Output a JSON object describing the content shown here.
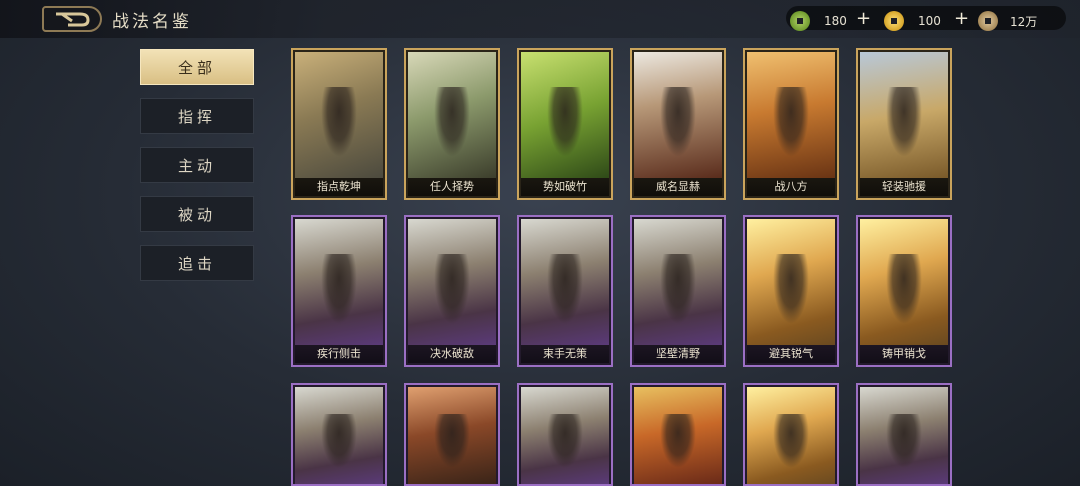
{
  "header": {
    "title": "战法名鉴"
  },
  "resources": [
    {
      "icon": "jade-coin-icon",
      "value": "180",
      "color": "#8db84a"
    },
    {
      "icon": "gold-coin-icon",
      "value": "100",
      "color": "#e0b030"
    },
    {
      "icon": "bronze-coin-icon",
      "value": "12万",
      "color": "#b69a68"
    }
  ],
  "sidebar": {
    "items": [
      {
        "label": "全部",
        "active": true
      },
      {
        "label": "指挥"
      },
      {
        "label": "主动"
      },
      {
        "label": "被动"
      },
      {
        "label": "追击"
      }
    ]
  },
  "cards": {
    "row1": [
      {
        "name": "指点乾坤",
        "quality": "gold"
      },
      {
        "name": "任人择势",
        "quality": "gold"
      },
      {
        "name": "势如破竹",
        "quality": "gold"
      },
      {
        "name": "威名显赫",
        "quality": "gold"
      },
      {
        "name": "战八方",
        "quality": "gold"
      },
      {
        "name": "轻装驰援",
        "quality": "gold"
      }
    ],
    "row2": [
      {
        "name": "疾行侧击",
        "quality": "purple"
      },
      {
        "name": "决水破敌",
        "quality": "purple"
      },
      {
        "name": "束手无策",
        "quality": "purple"
      },
      {
        "name": "坚壁清野",
        "quality": "purple"
      },
      {
        "name": "避其锐气",
        "quality": "purple"
      },
      {
        "name": "铸甲销戈",
        "quality": "purple"
      }
    ]
  },
  "colors": {
    "gold_border": "#caa45c",
    "purple_border": "#9b6fc4",
    "active_tab": "#e9d39c"
  }
}
